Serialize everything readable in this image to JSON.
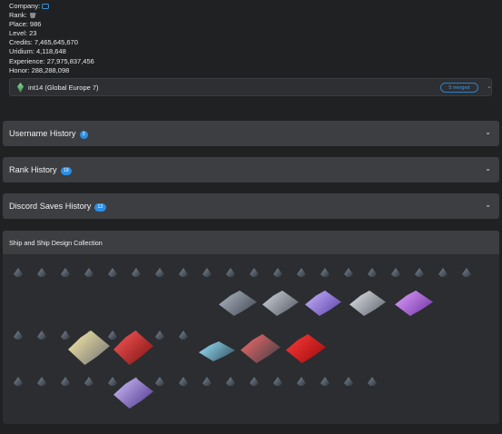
{
  "stats": {
    "company_label": "Company:",
    "rank_label": "Rank:",
    "place": "Place: 986",
    "level": "Level: 23",
    "credits": "Credits: 7,465,645,670",
    "uridium": "Uridium: 4,118,648",
    "experience": "Experience: 27,975,837,456",
    "honor": "Honor: 288,288,098"
  },
  "server": {
    "name": "int14 (Global Europe 7)",
    "merged": "5 merged"
  },
  "sections": [
    {
      "title": "Username History",
      "count": "3"
    },
    {
      "title": "Rank History",
      "count": "19"
    },
    {
      "title": "Discord Saves History",
      "count": "12"
    }
  ],
  "collection": {
    "title": "Ship and Ship Design Collection"
  },
  "icons": {
    "company": "company-icon",
    "rank": "rank-icon",
    "server": "gem-icon",
    "chevron": "chevron-down-icon"
  },
  "colors": {
    "accent": "#2a8ee6",
    "red_ship": "#e0262b",
    "purple_ship": "#8b6bd6"
  }
}
